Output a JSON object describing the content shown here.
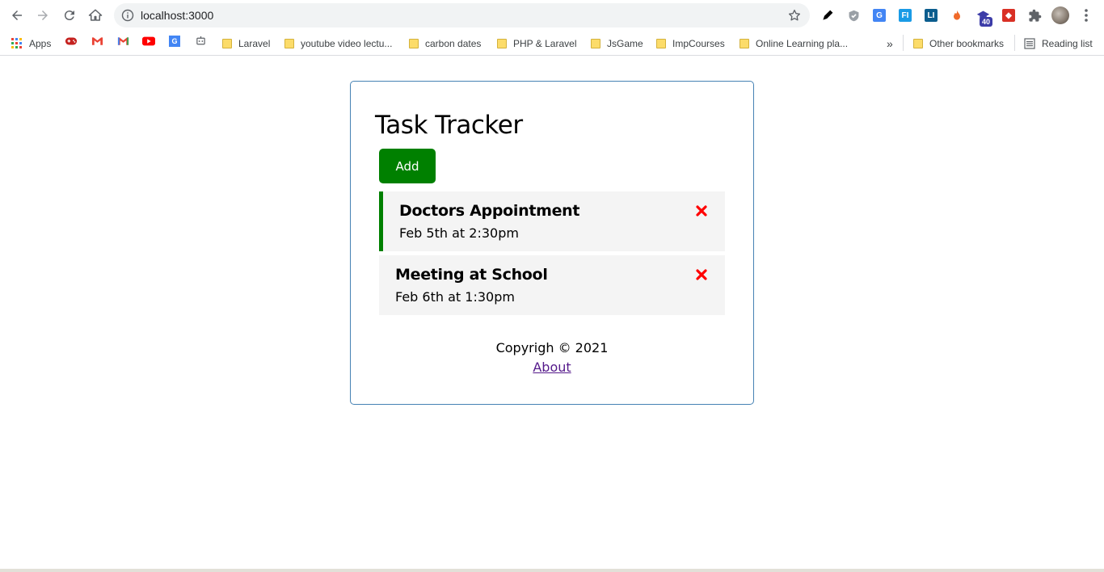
{
  "browser": {
    "url": "localhost:3000",
    "bookmarks": {
      "apps_label": "Apps",
      "folders": [
        "Laravel",
        "youtube video lectu...",
        "carbon dates",
        "PHP & Laravel",
        "JsGame",
        "ImpCourses",
        "Online Learning pla..."
      ],
      "overflow_label": "»",
      "other_bookmarks_label": "Other bookmarks",
      "reading_list_label": "Reading list"
    },
    "extension_badge": "40"
  },
  "app": {
    "title": "Task Tracker",
    "add_button_label": "Add",
    "tasks": [
      {
        "text": "Doctors Appointment",
        "day": "Feb 5th at 2:30pm",
        "reminder": true
      },
      {
        "text": "Meeting at School",
        "day": "Feb 6th at 1:30pm",
        "reminder": false
      }
    ],
    "footer": {
      "copyright": "Copyrigh © 2021",
      "about_link": "About"
    }
  },
  "colors": {
    "add_button": "#008000",
    "reminder_border": "#008000",
    "delete_icon": "#ff0000",
    "container_border": "steelblue",
    "task_bg": "#f4f4f4"
  }
}
